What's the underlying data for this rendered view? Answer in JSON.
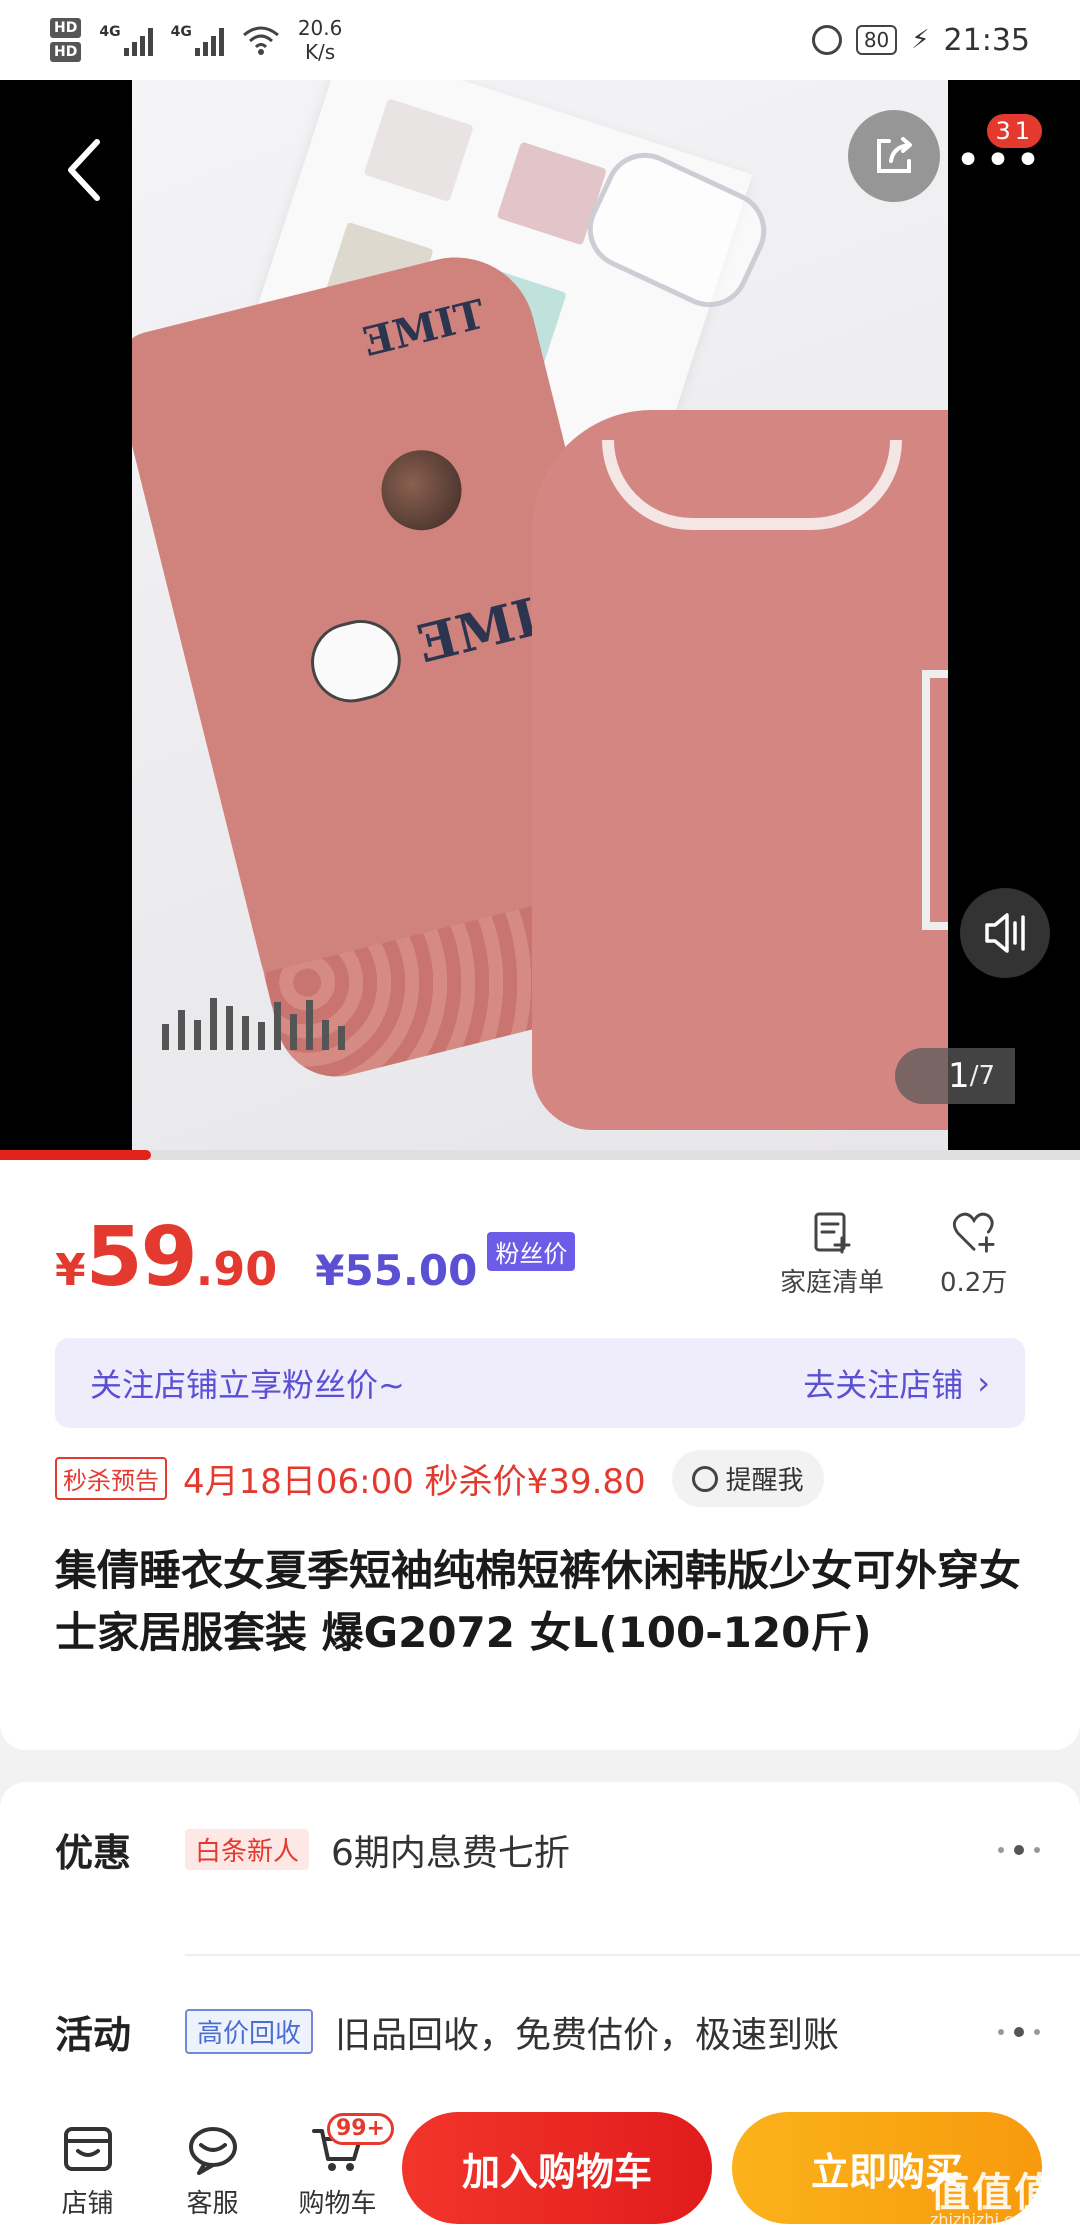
{
  "status_bar": {
    "hd1": "HD",
    "hd2": "HD",
    "net1": "4G",
    "net2": "4G",
    "speed_value": "20.6",
    "speed_unit": "K/s",
    "battery": "80",
    "time": "21:35"
  },
  "hero": {
    "more_badge": "31",
    "image_index": "1",
    "image_total": "/7",
    "gallery_progress": 0.14,
    "icons": {
      "back": "chevron-left-icon",
      "share": "share-icon",
      "more": "more-dots-icon",
      "audio": "audio-icon"
    }
  },
  "price": {
    "symbol": "¥",
    "integer": "59",
    "decimal": ".90",
    "fan_price": "¥55.00",
    "fan_tag": "粉丝价"
  },
  "actions": {
    "list_label": "家庭清单",
    "fav_label": "0.2万"
  },
  "follow_banner": {
    "text": "关注店铺立享粉丝价~",
    "link": "去关注店铺",
    "arrow": "›"
  },
  "flash_sale": {
    "tag": "秒杀预告",
    "text": "4月18日06:00 秒杀价¥39.80",
    "remind": "提醒我"
  },
  "product": {
    "title": "集倩睡衣女夏季短袖纯棉短裤休闲韩版少女可外穿女士家居服套装 爆G2072 女L(100-120斤)"
  },
  "details": {
    "promo": {
      "label": "优惠",
      "tag": "白条新人",
      "text": "6期内息费七折"
    },
    "activity": {
      "label": "活动",
      "tag": "高价回收",
      "text": "旧品回收，免费估价，极速到账"
    }
  },
  "bottom_bar": {
    "store": "店铺",
    "service": "客服",
    "cart": "购物车",
    "cart_badge": "99+",
    "add_to_cart": "加入购物车",
    "buy_now": "立即购买"
  },
  "watermark": {
    "logo": "值值值",
    "site": "zhizhizhi.com"
  },
  "colors": {
    "accent_red": "#e4392f",
    "fan_purple": "#5b4fd3",
    "buy_orange": "#f9a614"
  }
}
